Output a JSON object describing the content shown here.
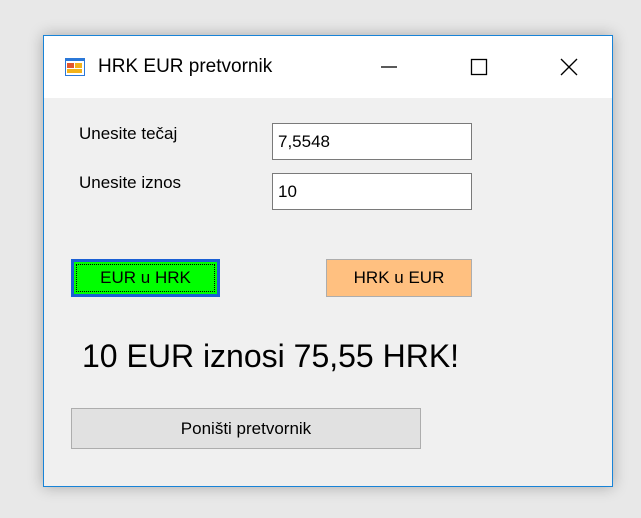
{
  "window": {
    "title": "HRK EUR pretvornik",
    "icon": "app-form-icon",
    "controls": {
      "minimize": "minimize-icon",
      "maximize": "maximize-icon",
      "close": "close-icon"
    }
  },
  "form": {
    "rate_label": "Unesite tečaj",
    "rate_value": "7,5548",
    "amount_label": "Unesite iznos",
    "amount_value": "10",
    "eur_to_hrk_label": "EUR u HRK",
    "hrk_to_eur_label": "HRK u EUR",
    "result_text": "10 EUR iznosi 75,55 HRK!",
    "reset_label": "Poništi pretvornik"
  },
  "colors": {
    "eur_to_hrk_bg": "#00ff00",
    "hrk_to_eur_bg": "#ffc080",
    "window_border": "#1883d7"
  }
}
